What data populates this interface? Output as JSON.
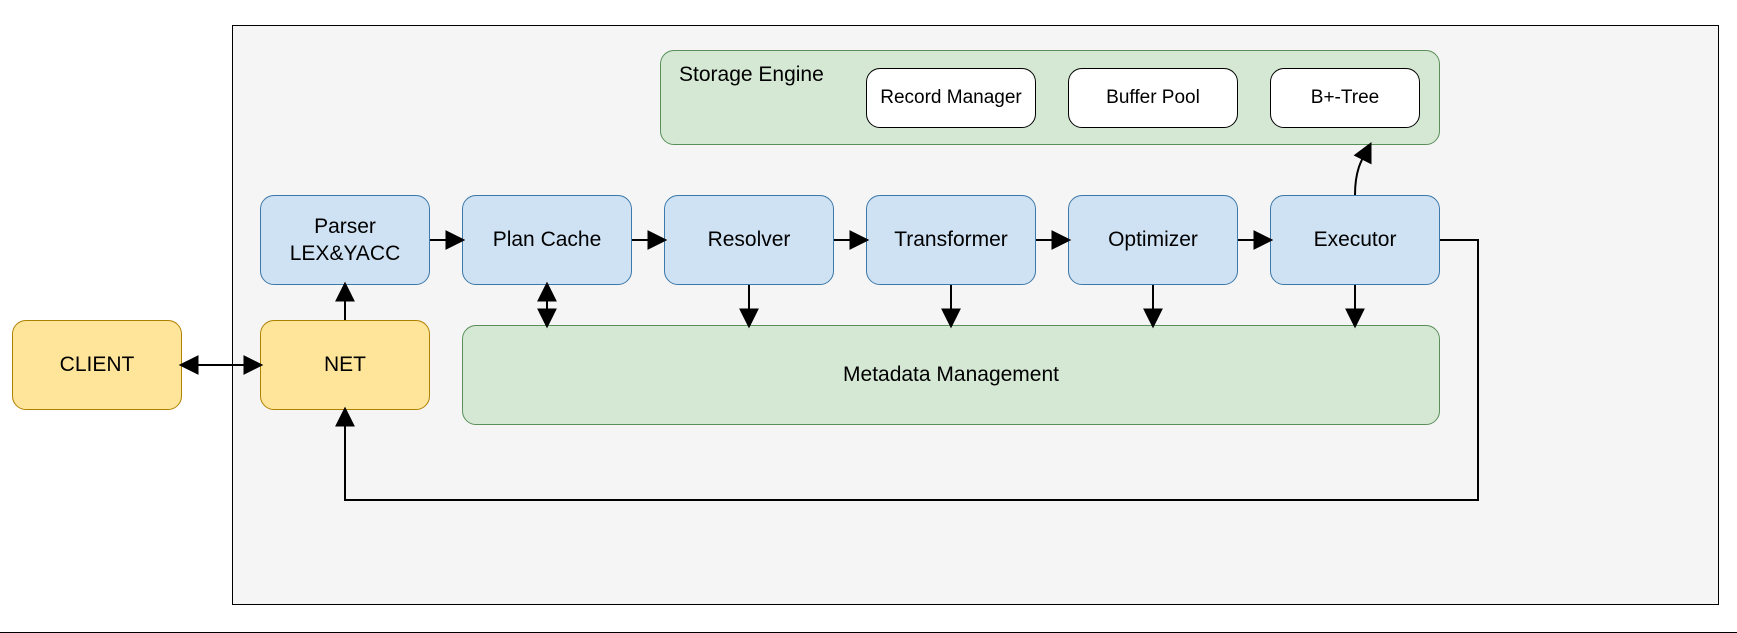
{
  "client": "CLIENT",
  "net": "NET",
  "parser_line1": "Parser",
  "parser_line2": "LEX&YACC",
  "plan_cache": "Plan Cache",
  "resolver": "Resolver",
  "transformer": "Transformer",
  "optimizer": "Optimizer",
  "executor": "Executor",
  "storage_engine": "Storage Engine",
  "record_manager": "Record Manager",
  "buffer_pool": "Buffer Pool",
  "bplus_tree": "B+-Tree",
  "metadata": "Metadata Management"
}
